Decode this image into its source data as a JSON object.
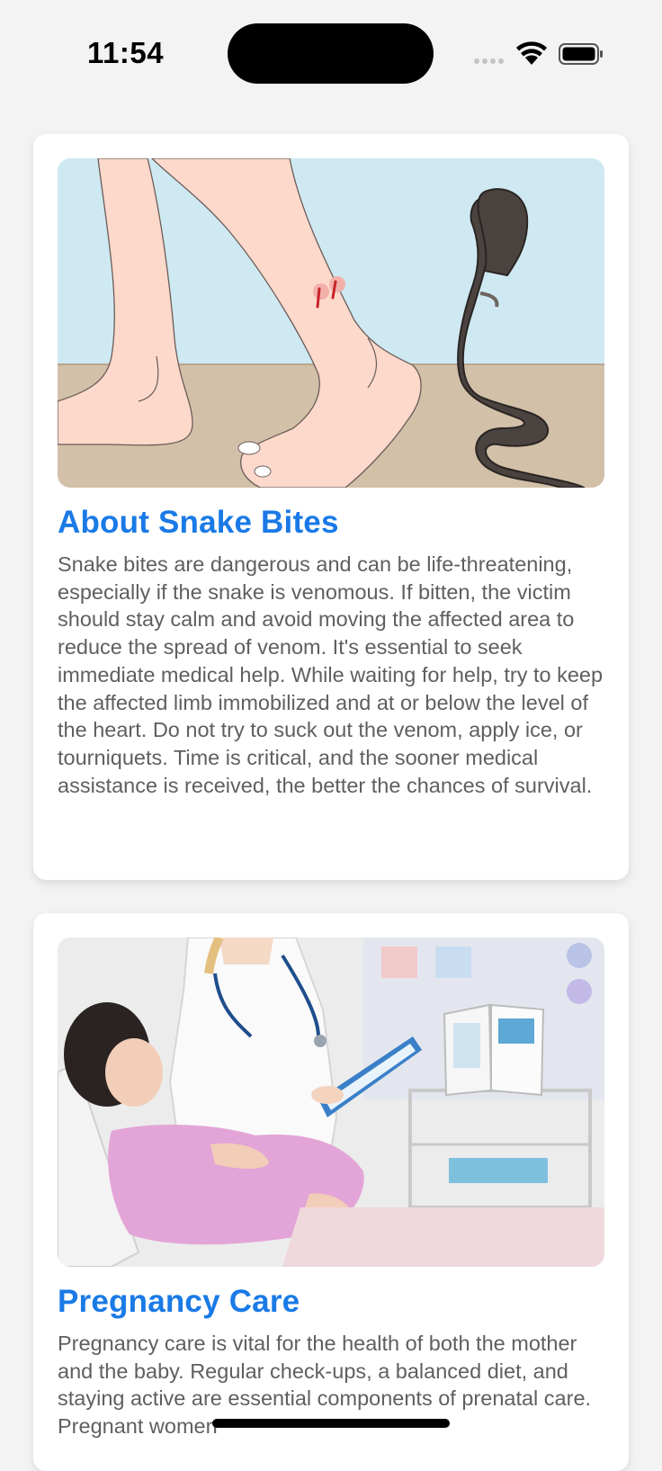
{
  "status_bar": {
    "time": "11:54",
    "icons": [
      "signal-dots-icon",
      "wifi-icon",
      "battery-icon"
    ]
  },
  "cards": [
    {
      "image": "snake-bite-illustration",
      "title": "About Snake Bites",
      "body": "Snake bites are dangerous and can be life-threatening, especially if the snake is venomous. If bitten, the victim should stay calm and avoid moving the affected area to reduce the spread of venom. It's essential to seek immediate medical help. While waiting for help, try to keep the affected limb immobilized and at or below the level of the heart. Do not try to suck out the venom, apply ice, or tourniquets. Time is critical, and the sooner medical assistance is received, the better the chances of survival."
    },
    {
      "image": "pregnancy-care-photo",
      "title": "Pregnancy Care",
      "body": "Pregnancy care is vital for the health of both the mother and the baby. Regular check-ups, a balanced diet, and staying active are essential components of prenatal care. Pregnant women"
    }
  ],
  "colors": {
    "title": "#1a7ae6",
    "body_text": "#5f5f5f",
    "background": "#f3f3f3"
  }
}
